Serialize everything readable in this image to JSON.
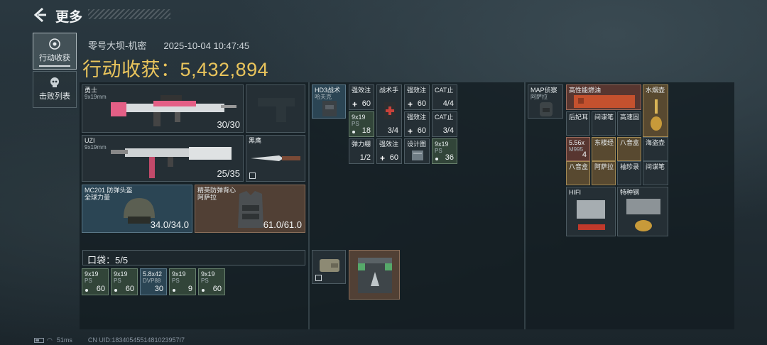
{
  "header": {
    "title": "更多"
  },
  "sidebar": {
    "tabs": [
      {
        "label": "行动收获",
        "active": true
      },
      {
        "label": "击败列表",
        "active": false
      }
    ]
  },
  "raid": {
    "map": "零号大坝-机密",
    "datetime": "2025-10-04 10:47:45",
    "gain_label": "行动收获：",
    "gain_value": "5,432,894"
  },
  "loadout": {
    "primary": {
      "name": "勇士",
      "ammo": "9x19mm",
      "count": "30/30"
    },
    "secondary": {
      "name": "UZI",
      "ammo": "9x19mm",
      "count": "25/35"
    },
    "melee": {
      "name": "黑鹰"
    },
    "helmet": {
      "name": "MC201 防弹头盔",
      "maker": "全球力量",
      "durability": "34.0/34.0"
    },
    "armor": {
      "name": "精英防弹背心",
      "maker": "阿萨拉",
      "durability": "61.0/61.0"
    }
  },
  "pocket": {
    "label": "口袋：5/5",
    "items": [
      {
        "name": "9x19",
        "sub": "PS",
        "qty": "60"
      },
      {
        "name": "9x19",
        "sub": "PS",
        "qty": "60"
      },
      {
        "name": "5.8x42",
        "sub": "DVP88",
        "qty": "30"
      },
      {
        "name": "9x19",
        "sub": "PS",
        "qty": "9"
      },
      {
        "name": "9x19",
        "sub": "PS",
        "qty": "60"
      }
    ]
  },
  "rig": {
    "name": "HD3战术",
    "sub": "哈夫克",
    "items": [
      {
        "name": "强效注",
        "qty": "60"
      },
      {
        "name": "战术手",
        "qty": "3/4"
      },
      {
        "name": "强效注",
        "qty": "60"
      },
      {
        "name": "CAT止",
        "qty": "4/4"
      },
      {
        "name": "9x19",
        "sub": "PS",
        "qty": "18"
      },
      {
        "name": "强效注",
        "qty": "60"
      },
      {
        "name": "CAT止",
        "qty": "3/4"
      },
      {
        "name": "弹力绷",
        "qty": "1/2"
      },
      {
        "name": "强效注",
        "qty": "60"
      },
      {
        "name": "设计图",
        "qty": ""
      },
      {
        "name": "9x19",
        "sub": "PS",
        "qty": "36"
      }
    ]
  },
  "backpack": {
    "name": "MAP侦察",
    "sub": "阿萨拉",
    "items": [
      {
        "name": "高性能燃油"
      },
      {
        "name": "水烟壶"
      },
      {
        "name": "后妃耳"
      },
      {
        "name": "间谍笔"
      },
      {
        "name": "高速固"
      },
      {
        "name": "5.56x",
        "sub": "M995",
        "qty": "4"
      },
      {
        "name": "东楼经"
      },
      {
        "name": "八音盒"
      },
      {
        "name": "海盗壶"
      },
      {
        "name": "八音盒"
      },
      {
        "name": "阿萨拉"
      },
      {
        "name": "袖珍录"
      },
      {
        "name": "间谍笔"
      },
      {
        "name": "HIFI"
      },
      {
        "name": "特种钢"
      }
    ]
  },
  "safebox": {},
  "footer": {
    "ping": "51ms",
    "uid": "CN UID:1834054551481023957I7"
  },
  "colors": {
    "accent_gold": "#e9c45c",
    "panel_bg": "#141d22"
  }
}
